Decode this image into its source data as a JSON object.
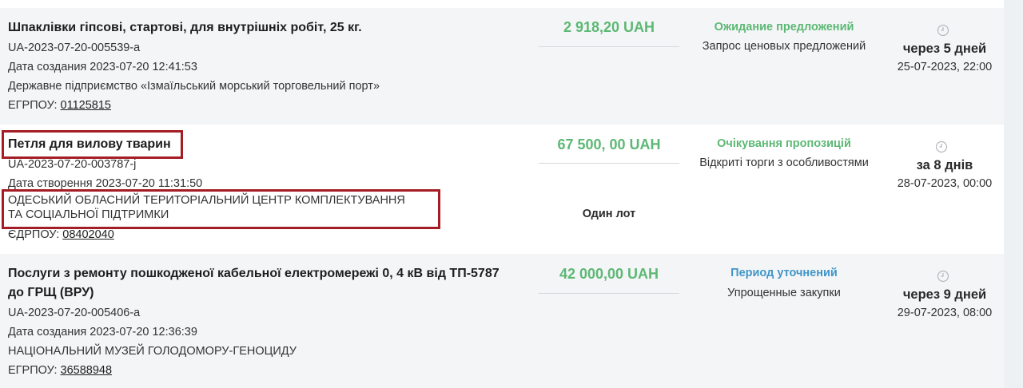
{
  "tenders": [
    {
      "title": "Шпаклівки гіпсові, стартові, для внутрішніх робіт, 25 кг.",
      "id": "UA-2023-07-20-005539-a",
      "created": "Дата создания 2023-07-20 12:41:53",
      "organization": "Державне підприємство «Ізмаїльський морський торговельний порт»",
      "edrpou_label": "ЕГРПОУ:",
      "edrpou": "01125815",
      "price": "2 918,20 UAH",
      "status": "Ожидание предложений",
      "procedure": "Запрос ценовых предложений",
      "deadline": "через 5 дней",
      "deadline_date": "25-07-2023, 22:00"
    },
    {
      "title": "Петля для вилову тварин",
      "id": "UA-2023-07-20-003787-j",
      "created": "Дата створення 2023-07-20 11:31:50",
      "organization_line1": "ОДЕСЬКИЙ ОБЛАСНИЙ ТЕРИТОРІАЛЬНИЙ ЦЕНТР КОМПЛЕКТУВАННЯ",
      "organization_line2": "ТА СОЦІАЛЬНОЇ ПІДТРИМКИ",
      "edrpou_label": "ЄДРПОУ:",
      "edrpou": "08402040",
      "price": "67 500, 00 UAH",
      "lot": "Один лот",
      "status": "Очікування пропозицій",
      "procedure": "Відкриті торги з особливостями",
      "deadline": "за 8 днів",
      "deadline_date": "28-07-2023, 00:00"
    },
    {
      "title_line1": "Послуги з ремонту пошкодженої кабельної електромережі 0, 4 кВ від ТП-5787",
      "title_line2": "до ГРЩ (ВРУ)",
      "id": "UA-2023-07-20-005406-a",
      "created": "Дата создания 2023-07-20 12:36:39",
      "organization": "НАЦІОНАЛЬНИЙ МУЗЕЙ ГОЛОДОМОРУ-ГЕНОЦИДУ",
      "edrpou_label": "ЕГРПОУ:",
      "edrpou": "36588948",
      "price": "42 000,00 UAH",
      "status": "Период уточнений",
      "procedure": "Упрощенные закупки",
      "deadline": "через 9 дней",
      "deadline_date": "29-07-2023, 08:00"
    }
  ],
  "colors": {
    "price_green": "#5cb874",
    "status_blue": "#3f96c8",
    "highlight_red": "#a51d24"
  },
  "icons": {
    "deadline": "clock-icon"
  }
}
